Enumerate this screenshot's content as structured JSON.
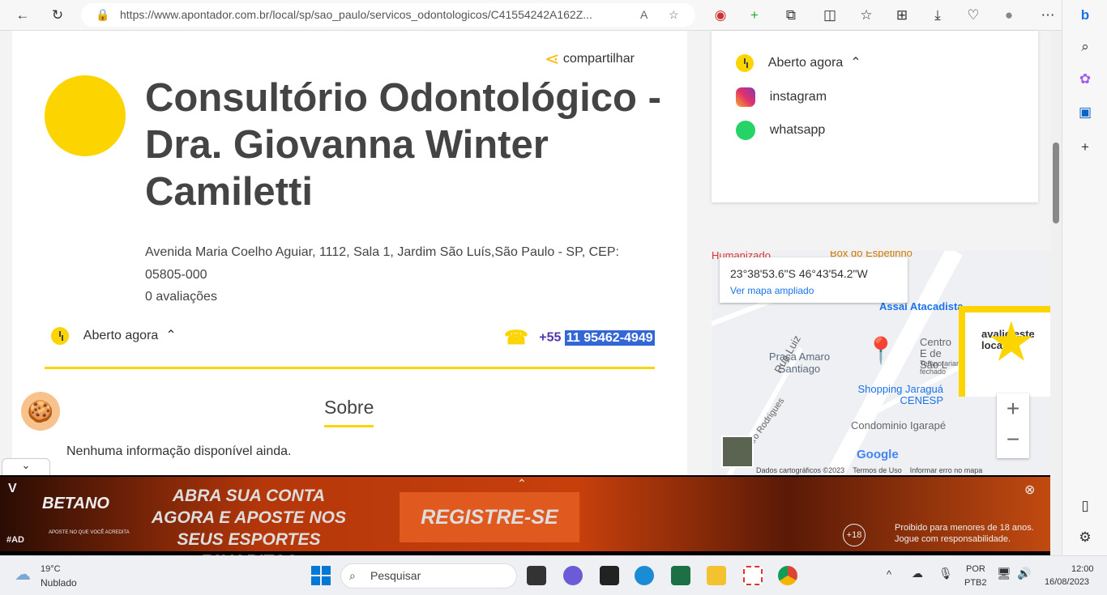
{
  "browser": {
    "url": "https://www.apontador.com.br/local/sp/sao_paulo/servicos_odontologicos/C41554242A162Z..."
  },
  "main": {
    "share_label": "compartilhar",
    "title": "Consultório Odontológico - Dra. Giovanna Winter Camiletti",
    "address": "Avenida Maria Coelho Aguiar, 1112, Sala 1, Jardim São Luís,São Paulo - SP, CEP: 05805-000",
    "reviews": "0 avaliações",
    "open_status": "Aberto agora",
    "phone_prefix": "+55",
    "phone_number": "11 95462-4949",
    "about_heading": "Sobre",
    "about_text": "Nenhuma informação disponível ainda."
  },
  "side_card": {
    "open_status": "Aberto agora",
    "instagram": "instagram",
    "whatsapp": "whatsapp"
  },
  "map": {
    "coords": "23°38'53.6\"S 46°43'54.2\"W",
    "enlarge_link": "Ver mapa ampliado",
    "labels": [
      "Humanizado",
      "Box do Espetinho",
      "Assaí Atacadista",
      "Rua Luiz",
      "Praça Amaro Santiago",
      "Centro E de São L",
      "Temporariamente fechado",
      "Shopping Jaraguá CENESP",
      "Condominio Igarapé",
      "Amaro Rodrigues"
    ],
    "google": "Google",
    "footer": [
      "Dados cartográficos ©2023",
      "Termos de Uso",
      "Informar erro no mapa"
    ],
    "rate_prompt": "avalie este local"
  },
  "ad": {
    "brand": "BETANO",
    "tagline": "APOSTE NO QUE VOCÊ ACREDITA",
    "headline": "ABRA SUA CONTA AGORA E APOSTE NOS SEUS ESPORTES FAVORITOS",
    "cta": "REGISTRE-SE",
    "hashtag": "#AD",
    "age_badge": "+18",
    "warning": "Proibido para menores de 18 anos. Jogue com responsabilidade."
  },
  "taskbar": {
    "weather_temp": "19°C",
    "weather_desc": "Nublado",
    "search_placeholder": "Pesquisar",
    "lang1": "POR",
    "lang2": "PTB2",
    "time": "12:00",
    "date": "16/08/2023"
  },
  "colors": {
    "accent": "#fcd400",
    "link": "#1a73e8",
    "phone": "#5533aa"
  }
}
